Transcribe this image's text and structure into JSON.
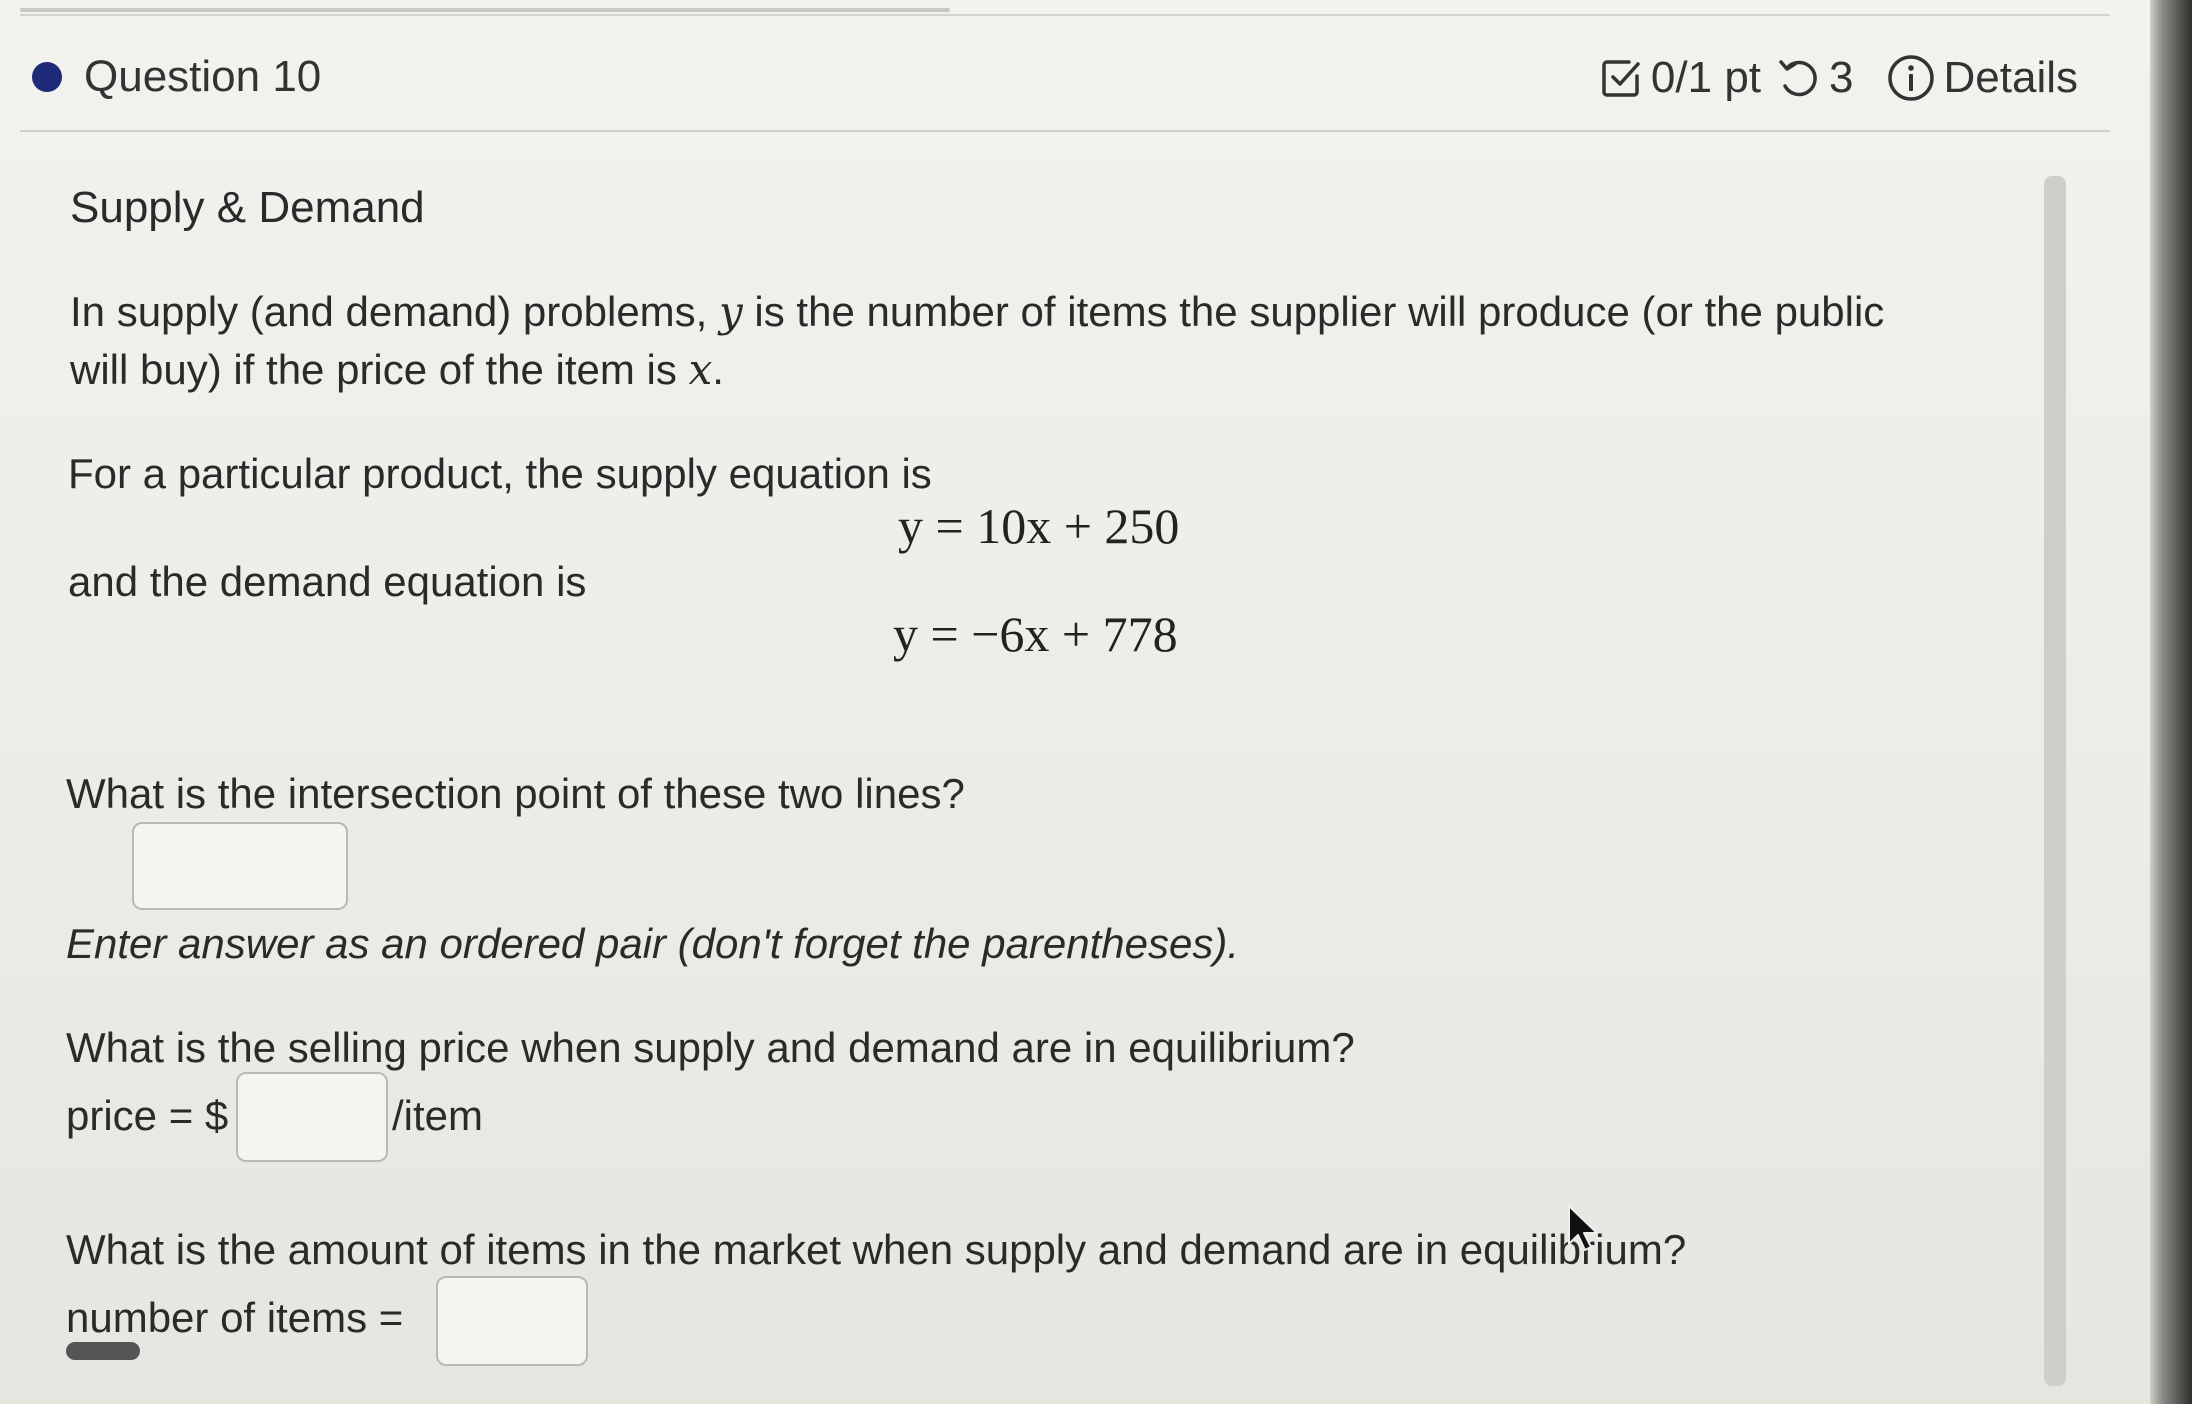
{
  "header": {
    "question_label": "Question 10",
    "score": "0/1 pt",
    "attempts": "3",
    "details_label": "Details"
  },
  "problem": {
    "title": "Supply & Demand",
    "intro_part1": "In supply (and demand) problems,",
    "intro_var_y": "y",
    "intro_part2": "is the number of items the supplier will produce (or the public",
    "intro_line2_part1": "will buy) if the price of the item is",
    "intro_var_x": "x",
    "intro_line2_end": ".",
    "supply_intro": "For a particular product, the supply equation is",
    "supply_equation": "y = 10x + 250",
    "demand_intro": "and the demand equation is",
    "demand_equation": "y = −6x + 778"
  },
  "q1": {
    "prompt": "What is the intersection point of these two lines?",
    "value": "",
    "hint": "Enter answer as an ordered pair (don't forget the parentheses)."
  },
  "q2": {
    "prompt": "What is the selling price when supply and demand are in equilibrium?",
    "label": "price = $",
    "value": "",
    "unit": "/item"
  },
  "q3": {
    "prompt": "What is the amount of items in the market when supply and demand are in equilibrium?",
    "label": "number of items =",
    "value": ""
  },
  "colors": {
    "question_dot": "#1e2a78",
    "page_background": "#f3f2ee",
    "input_border": "#b9b8b2"
  },
  "icons": {
    "score": "checkbox-icon",
    "attempts": "retry-icon",
    "details": "info-circle-icon"
  }
}
